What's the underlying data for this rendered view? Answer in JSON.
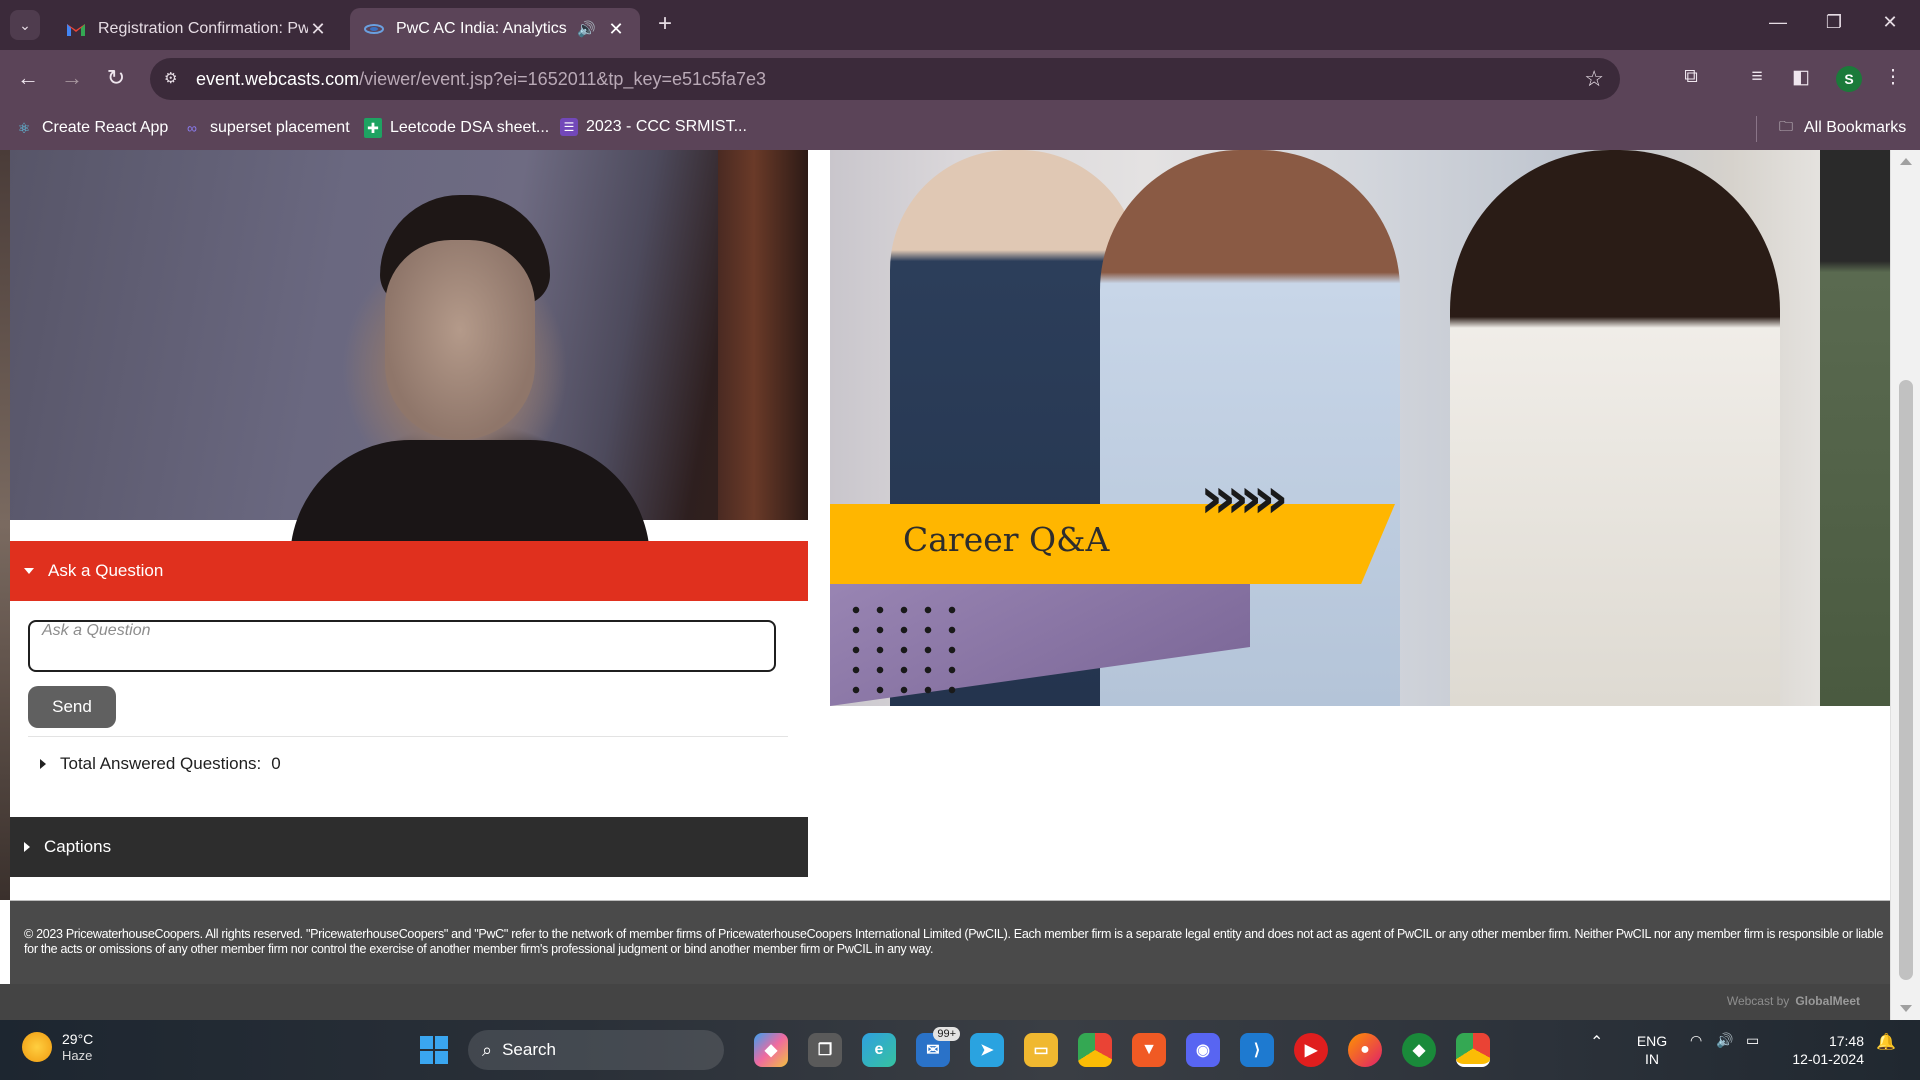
{
  "browser": {
    "tabs": [
      {
        "title": "Registration Confirmation: PwC",
        "icon": "gmail-icon",
        "active": false
      },
      {
        "title": "PwC AC India: Analytics Insi",
        "icon": "webcast-icon",
        "active": true,
        "audio": "🔊"
      }
    ],
    "new_tab": "+",
    "url_host": "event.webcasts.com",
    "url_path": "/viewer/event.jsp?ei=1652011&tp_key=e51c5fa7e3",
    "profile_initial": "S",
    "bookmarks": [
      {
        "label": "Create React App",
        "icon": "react-icon"
      },
      {
        "label": "superset placement",
        "icon": "superset-icon"
      },
      {
        "label": "Leetcode DSA sheet...",
        "icon": "sheets-icon"
      },
      {
        "label": "2023 - CCC SRMIST...",
        "icon": "list-icon"
      }
    ],
    "all_bookmarks": "All Bookmarks"
  },
  "page": {
    "qa_header": "Ask a Question",
    "question_placeholder": "Ask a Question",
    "send_label": "Send",
    "answered_label": "Total Answered Questions:",
    "answered_count": "0",
    "captions_header": "Captions",
    "banner_title": "Career Q&A",
    "banner_chevrons": "»»»",
    "footer_text": "© 2023 PricewaterhouseCoopers. All rights reserved. \"PricewaterhouseCoopers\"  and \"PwC\" refer to the network of member firms of PricewaterhouseCoopers  International Limited (PwCIL). Each member firm is a separate legal entity and  does not act as agent of PwCIL or any other member firm. Neither PwCIL nor any  member firm is responsible or liable for the acts or omissions of any other  member firm nor control the exercise of another member firm's professional  judgment or bind another member firm or PwCIL in any way.",
    "webcast_by": "Webcast by",
    "globalmeet": "GlobalMeet"
  },
  "taskbar": {
    "weather_temp": "29°C",
    "weather_cond": "Haze",
    "search_label": "Search",
    "mail_badge": "99+",
    "lang_top": "ENG",
    "lang_bottom": "IN",
    "time": "17:48",
    "date": "12-01-2024"
  },
  "colors": {
    "accent_red": "#e0301e",
    "ribbon_yellow": "#ffb600",
    "captions_dark": "#2d2d2d",
    "chrome_purple": "#5b4458"
  }
}
